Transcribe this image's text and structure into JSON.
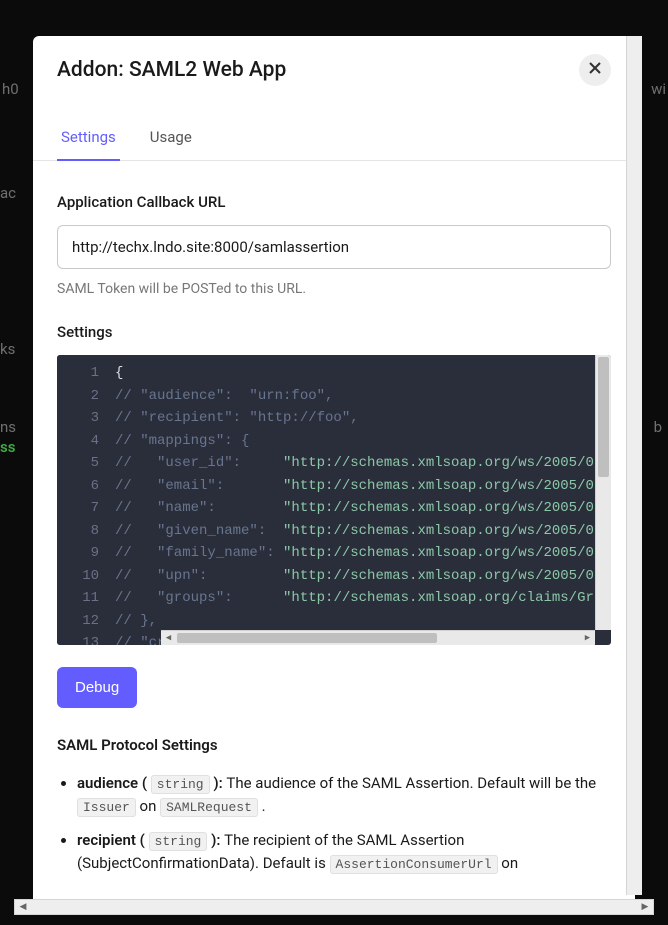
{
  "modal": {
    "title": "Addon: SAML2 Web App"
  },
  "tabs": {
    "settings": "Settings",
    "usage": "Usage"
  },
  "callback": {
    "label": "Application Callback URL",
    "value": "http://techx.lndo.site:8000/samlassertion",
    "help": "SAML Token will be POSTed to this URL."
  },
  "settings": {
    "label": "Settings",
    "lines": [
      {
        "n": "1",
        "tokens": [
          {
            "c": "tok-brace",
            "t": "{"
          }
        ]
      },
      {
        "n": "2",
        "tokens": [
          {
            "c": "tok-comment",
            "t": "// \"audience\":  \"urn:foo\","
          }
        ]
      },
      {
        "n": "3",
        "tokens": [
          {
            "c": "tok-comment",
            "t": "// \"recipient\": \"http://foo\","
          }
        ]
      },
      {
        "n": "4",
        "tokens": [
          {
            "c": "tok-comment",
            "t": "// \"mappings\": {"
          }
        ]
      },
      {
        "n": "5",
        "tokens": [
          {
            "c": "tok-comment",
            "t": "//   \"user_id\":     "
          },
          {
            "c": "tok-string",
            "t": "\"http://schemas.xmlsoap.org/ws/2005/0"
          }
        ]
      },
      {
        "n": "6",
        "tokens": [
          {
            "c": "tok-comment",
            "t": "//   \"email\":       "
          },
          {
            "c": "tok-string",
            "t": "\"http://schemas.xmlsoap.org/ws/2005/0"
          }
        ]
      },
      {
        "n": "7",
        "tokens": [
          {
            "c": "tok-comment",
            "t": "//   \"name\":        "
          },
          {
            "c": "tok-string",
            "t": "\"http://schemas.xmlsoap.org/ws/2005/0"
          }
        ]
      },
      {
        "n": "8",
        "tokens": [
          {
            "c": "tok-comment",
            "t": "//   \"given_name\":  "
          },
          {
            "c": "tok-string",
            "t": "\"http://schemas.xmlsoap.org/ws/2005/0"
          }
        ]
      },
      {
        "n": "9",
        "tokens": [
          {
            "c": "tok-comment",
            "t": "//   \"family_name\": "
          },
          {
            "c": "tok-string",
            "t": "\"http://schemas.xmlsoap.org/ws/2005/0"
          }
        ]
      },
      {
        "n": "10",
        "tokens": [
          {
            "c": "tok-comment",
            "t": "//   \"upn\":         "
          },
          {
            "c": "tok-string",
            "t": "\"http://schemas.xmlsoap.org/ws/2005/0"
          }
        ]
      },
      {
        "n": "11",
        "tokens": [
          {
            "c": "tok-comment",
            "t": "//   \"groups\":      "
          },
          {
            "c": "tok-string",
            "t": "\"http://schemas.xmlsoap.org/claims/Gr"
          }
        ]
      },
      {
        "n": "12",
        "tokens": [
          {
            "c": "tok-comment",
            "t": "// },"
          }
        ]
      },
      {
        "n": "13",
        "tokens": [
          {
            "c": "tok-comment",
            "t": "// \"createUpnClaim\":       true,"
          }
        ]
      }
    ]
  },
  "debug": {
    "label": "Debug"
  },
  "protocol": {
    "heading": "SAML Protocol Settings",
    "items": [
      {
        "name": "audience",
        "type": "string",
        "desc_prefix": "The audience of the SAML Assertion. Default will be the ",
        "code1": "Issuer",
        "mid": " on ",
        "code2": "SAMLRequest",
        "suffix": " ."
      },
      {
        "name": "recipient",
        "type": "string",
        "desc_prefix": "The recipient of the SAML Assertion (SubjectConfirmationData). Default is ",
        "code1": "AssertionConsumerUrl",
        "mid": " on ",
        "code2": "",
        "suffix": ""
      }
    ]
  },
  "bg": {
    "frag1": "h0",
    "frag2": "ac",
    "frag3": "ks",
    "frag4": "ns",
    "frag5": "ss",
    "frag6": "wi",
    "frag7": "b"
  }
}
